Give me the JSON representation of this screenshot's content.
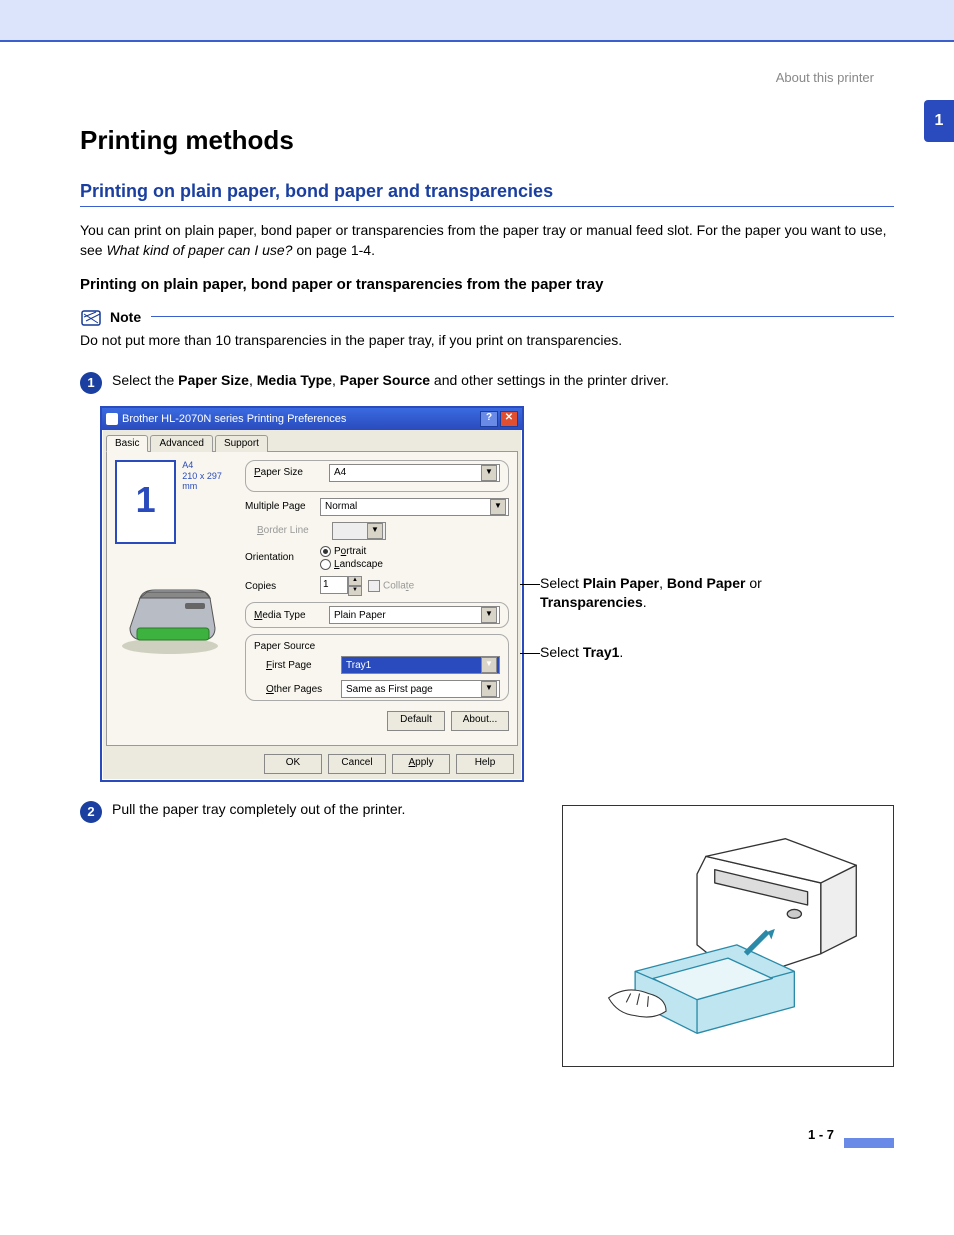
{
  "header_link": "About this printer",
  "side_tab": "1",
  "h1": "Printing methods",
  "h2": "Printing on plain paper, bond paper and transparencies",
  "intro_a": "You can print on plain paper, bond paper or transparencies from the paper tray or manual feed slot. For the paper you want to use, see ",
  "intro_italic": "What kind of paper can I use?",
  "intro_b": " on page 1-4.",
  "h3": "Printing on plain paper, bond paper or transparencies from the paper tray",
  "note_label": "Note",
  "note_text": "Do not put more than 10 transparencies in the paper tray, if you print on transparencies.",
  "step1_pre": "Select the ",
  "step1_b1": "Paper Size",
  "step1_m1": ", ",
  "step1_b2": "Media Type",
  "step1_m2": ", ",
  "step1_b3": "Paper Source",
  "step1_post": " and other settings in the printer driver.",
  "dialog": {
    "title": "Brother HL-2070N series Printing Preferences",
    "help_btn": "?",
    "close_btn": "✕",
    "tabs": {
      "basic": "Basic",
      "advanced": "Advanced",
      "support": "Support"
    },
    "thumb_num": "1",
    "thumb_meta1": "A4",
    "thumb_meta2": "210 x 297 mm",
    "labels": {
      "paper_size": "Paper Size",
      "multiple_page": "Multiple Page",
      "border_line": "Border Line",
      "orientation": "Orientation",
      "copies": "Copies",
      "media_type": "Media Type",
      "paper_source": "Paper Source",
      "first_page": "First Page",
      "other_pages": "Other Pages"
    },
    "values": {
      "paper_size": "A4",
      "multiple_page": "Normal",
      "portrait": "Portrait",
      "landscape": "Landscape",
      "copies": "1",
      "collate": "Collate",
      "media_type": "Plain Paper",
      "first_page": "Tray1",
      "other_pages": "Same as First page"
    },
    "buttons": {
      "default": "Default",
      "about": "About...",
      "ok": "OK",
      "cancel": "Cancel",
      "apply": "Apply",
      "help": "Help"
    }
  },
  "callout1_a": "Select ",
  "callout1_b1": "Plain Paper",
  "callout1_m1": ", ",
  "callout1_b2": "Bond Paper",
  "callout1_m2": " or ",
  "callout1_b3": "Transparencies",
  "callout1_end": ".",
  "callout2_a": "Select ",
  "callout2_b": "Tray1",
  "callout2_end": ".",
  "step2_text": "Pull the paper tray completely out of the printer.",
  "footer": "1 - 7"
}
